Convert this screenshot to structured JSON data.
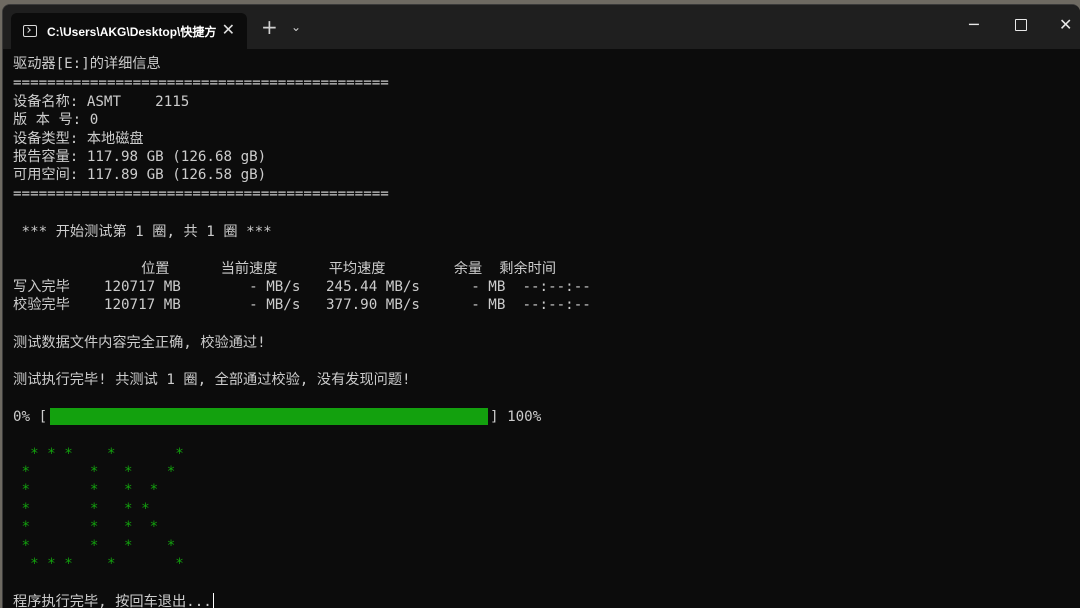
{
  "window": {
    "tab_title": "C:\\Users\\AKG\\Desktop\\快捷方",
    "tab_close": "✕",
    "new_tab": "+",
    "tab_dropdown": "⌄",
    "minimize": "─",
    "close": "✕"
  },
  "terminal": {
    "lines": [
      "驱动器[E:]的详细信息",
      "============================================",
      "设备名称: ASMT    2115",
      "版 本 号: 0",
      "设备类型: 本地磁盘",
      "报告容量: 117.98 GB (126.68 gB)",
      "可用空间: 117.89 GB (126.58 gB)",
      "============================================",
      "",
      " *** 开始测试第 1 圈, 共 1 圈 ***",
      "",
      "               位置      当前速度      平均速度        余量  剩余时间",
      "写入完毕    120717 MB        - MB/s   245.44 MB/s      - MB  --:--:--",
      "校验完毕    120717 MB        - MB/s   377.90 MB/s      - MB  --:--:--",
      "",
      "测试数据文件内容完全正确, 校验通过!",
      "",
      "测试执行完毕! 共测试 1 圈, 全部通过校验, 没有发现问题!"
    ],
    "progress": {
      "left_label": "0% [",
      "right_label": "] 100%",
      "percent": 100
    },
    "ok_art": [
      "  * * *    *       *",
      " *       *   *    *",
      " *       *   *  *",
      " *       *   * *",
      " *       *   *  *",
      " *       *   *    *",
      "  * * *    *       *"
    ],
    "prompt": "程序执行完毕, 按回车退出..."
  },
  "colors": {
    "terminal_bg": "#0c0c0c",
    "text": "#cccccc",
    "accent_green": "#13a10e"
  }
}
